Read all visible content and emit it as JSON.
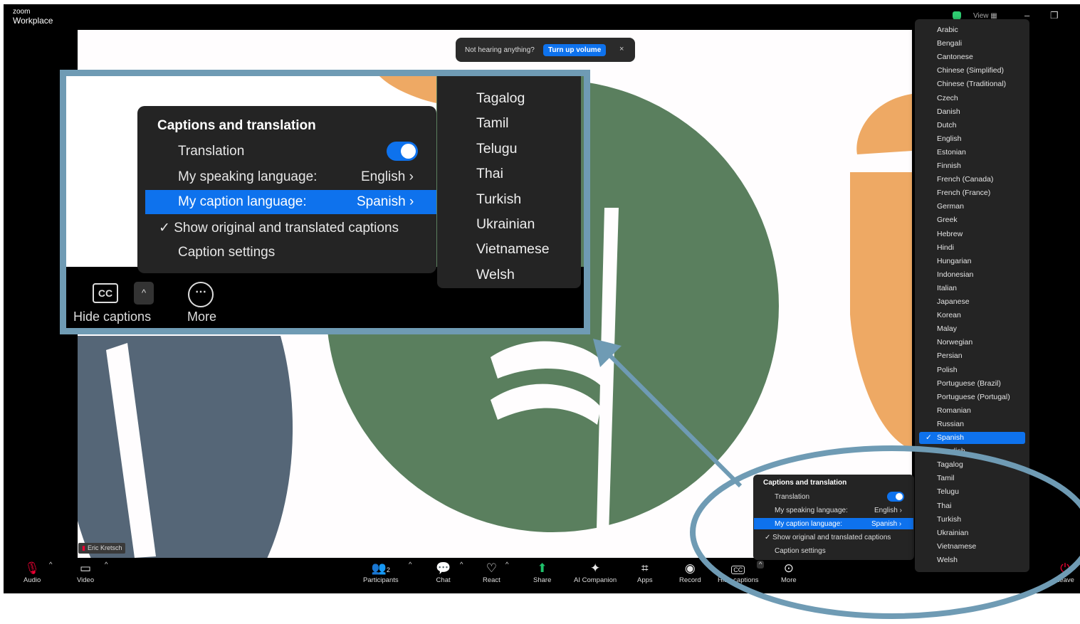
{
  "app": {
    "brand_small": "zoom",
    "brand_name": "Workplace",
    "view_label": "View"
  },
  "notice": {
    "text": "Not hearing anything?",
    "button": "Turn up volume",
    "close": "×"
  },
  "participant_name": "Eric Kretsch",
  "toolbar": {
    "audio": "Audio",
    "video": "Video",
    "participants": "Participants",
    "participants_count": "2",
    "chat": "Chat",
    "react": "React",
    "share": "Share",
    "ai_companion": "AI Companion",
    "apps": "Apps",
    "record": "Record",
    "hide_captions": "Hide captions",
    "more": "More",
    "leave": "Leave"
  },
  "captions_menu": {
    "title": "Captions and translation",
    "translation": "Translation",
    "speaking_label": "My speaking language:",
    "speaking_value": "English",
    "caption_label": "My caption language:",
    "caption_value": "Spanish",
    "show_original": "Show original and translated captions",
    "settings": "Caption settings",
    "check": "✓",
    "arrow": "›"
  },
  "languages": [
    "Arabic",
    "Bengali",
    "Cantonese",
    "Chinese (Simplified)",
    "Chinese (Traditional)",
    "Czech",
    "Danish",
    "Dutch",
    "English",
    "Estonian",
    "Finnish",
    "French (Canada)",
    "French (France)",
    "German",
    "Greek",
    "Hebrew",
    "Hindi",
    "Hungarian",
    "Indonesian",
    "Italian",
    "Japanese",
    "Korean",
    "Malay",
    "Norwegian",
    "Persian",
    "Polish",
    "Portuguese (Brazil)",
    "Portuguese (Portugal)",
    "Romanian",
    "Russian",
    "Spanish",
    "Swedish",
    "Tagalog",
    "Tamil",
    "Telugu",
    "Thai",
    "Turkish",
    "Ukrainian",
    "Vietnamese",
    "Welsh"
  ],
  "selected_language": "Spanish",
  "zoomed_languages": [
    "Tagalog",
    "Tamil",
    "Telugu",
    "Thai",
    "Turkish",
    "Ukrainian",
    "Vietnamese",
    "Welsh"
  ],
  "colors": {
    "accent": "#0e72ed",
    "callout": "#6f9bb4",
    "green": "#5a7f5e",
    "orange": "#eea964",
    "slate": "#556677"
  }
}
